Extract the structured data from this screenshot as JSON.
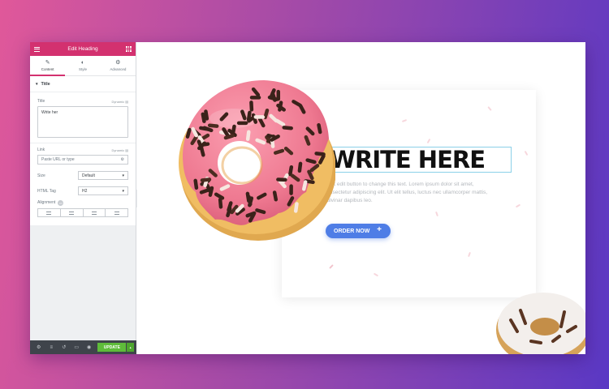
{
  "editor": {
    "header_title": "Edit Heading",
    "tabs": [
      {
        "label": "Content",
        "icon": "pencil-icon"
      },
      {
        "label": "Style",
        "icon": "half-circle-icon"
      },
      {
        "label": "Advanced",
        "icon": "gear-icon"
      }
    ],
    "section_title": "Title",
    "title_label": "Title",
    "dynamic_label": "Dynamic",
    "title_value": "Write her",
    "link_label": "Link",
    "link_placeholder": "Paste URL or type",
    "size_label": "Size",
    "size_value": "Default",
    "html_tag_label": "HTML Tag",
    "html_tag_value": "H2",
    "alignment_label": "Alignment",
    "update_label": "UPDATE"
  },
  "canvas": {
    "heading": "WRITE HERE",
    "description": "Click edit button to change this text. Lorem ipsum dolor sit amet, consectetur adipiscing elit. Ut elit tellus, luctus nec ullamcorper mattis, pulvinar dapibus leo.",
    "button_label": "ORDER NOW",
    "button_icon": "plus-icon"
  },
  "colors": {
    "accent": "#d3316f",
    "button": "#4e7de6",
    "update": "#5ebc3a"
  }
}
